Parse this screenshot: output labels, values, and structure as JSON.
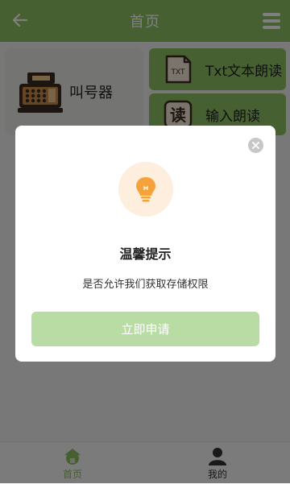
{
  "header": {
    "title": "首页",
    "back_icon": "arrow-left-icon",
    "menu_icon": "hamburger-menu-icon"
  },
  "main": {
    "big_card": {
      "label": "叫号器",
      "icon": "cash-register-icon"
    },
    "cards": [
      {
        "label": "Txt文本朗读",
        "icon": "txt-file-icon",
        "icon_text": "TXT"
      },
      {
        "label": "输入朗读",
        "icon": "read-badge-icon",
        "icon_text": "读"
      }
    ]
  },
  "bottom_nav": [
    {
      "label": "首页",
      "icon": "home-icon",
      "active": true
    },
    {
      "label": "我的",
      "icon": "user-icon",
      "active": false
    }
  ],
  "dialog": {
    "title": "温馨提示",
    "message": "是否允许我们获取存储权限",
    "button": "立即申请",
    "icon": "lightbulb-icon",
    "close_icon": "close-icon"
  },
  "colors": {
    "primary": "#8fc163",
    "dialog_button": "#b9dca5",
    "bulb": "#f5a23a",
    "bulb_bg": "#fdeedd"
  }
}
